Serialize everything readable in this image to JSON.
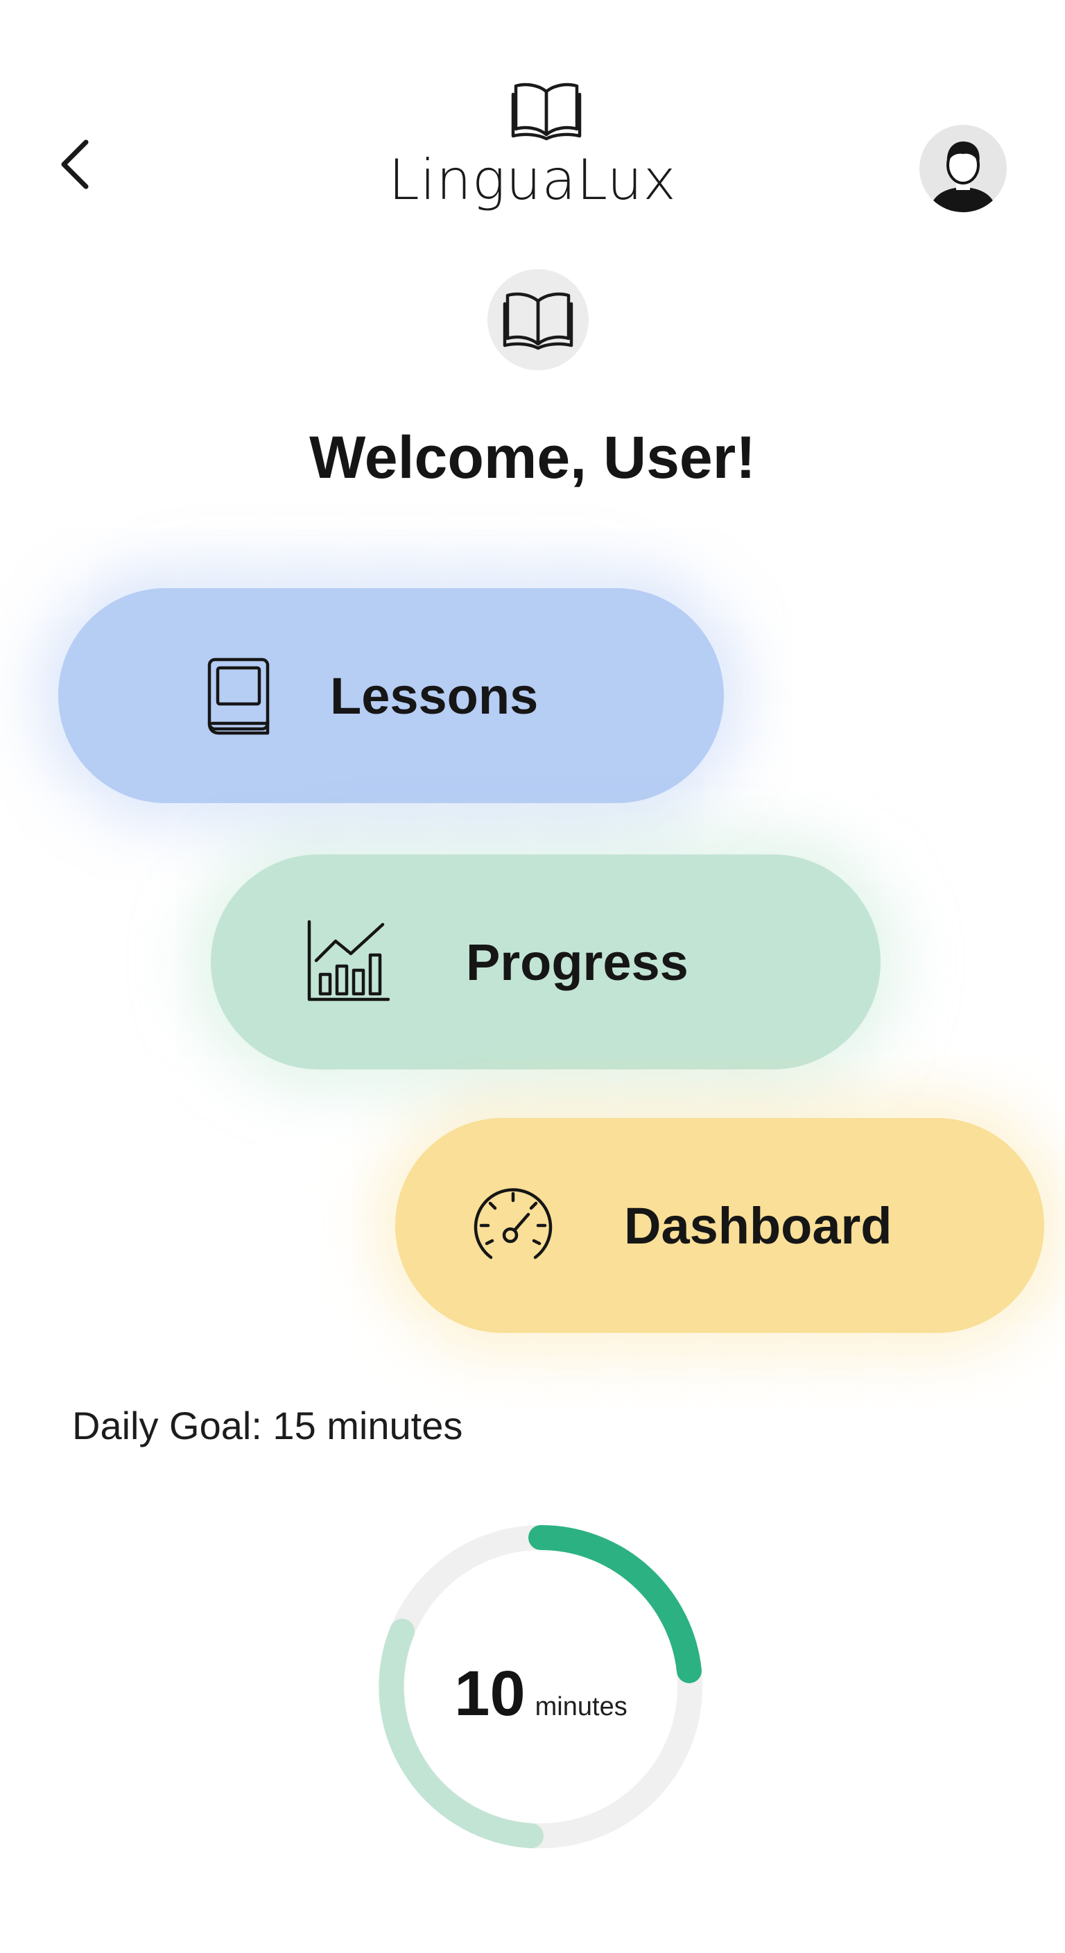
{
  "header": {
    "title": "LinguaLux",
    "back_icon": "chevron-left-icon",
    "logo_icon": "open-book-icon",
    "avatar_icon": "user-avatar-icon"
  },
  "hero": {
    "icon": "open-book-icon",
    "welcome": "Welcome, User!"
  },
  "nav": {
    "items": [
      {
        "label": "Lessons",
        "icon": "book-icon",
        "color": "#b6cdf4"
      },
      {
        "label": "Progress",
        "icon": "bar-chart-icon",
        "color": "#c2e4d4"
      },
      {
        "label": "Dashboard",
        "icon": "speedometer-icon",
        "color": "#f9df97"
      }
    ]
  },
  "daily_goal": {
    "label": "Daily Goal: 15 minutes",
    "value": "10",
    "unit": "minutes",
    "progress_fraction": 0.667,
    "colors": {
      "track": "#f0f0f0",
      "completed": "#c2e4d4",
      "accent": "#2cb282"
    }
  }
}
